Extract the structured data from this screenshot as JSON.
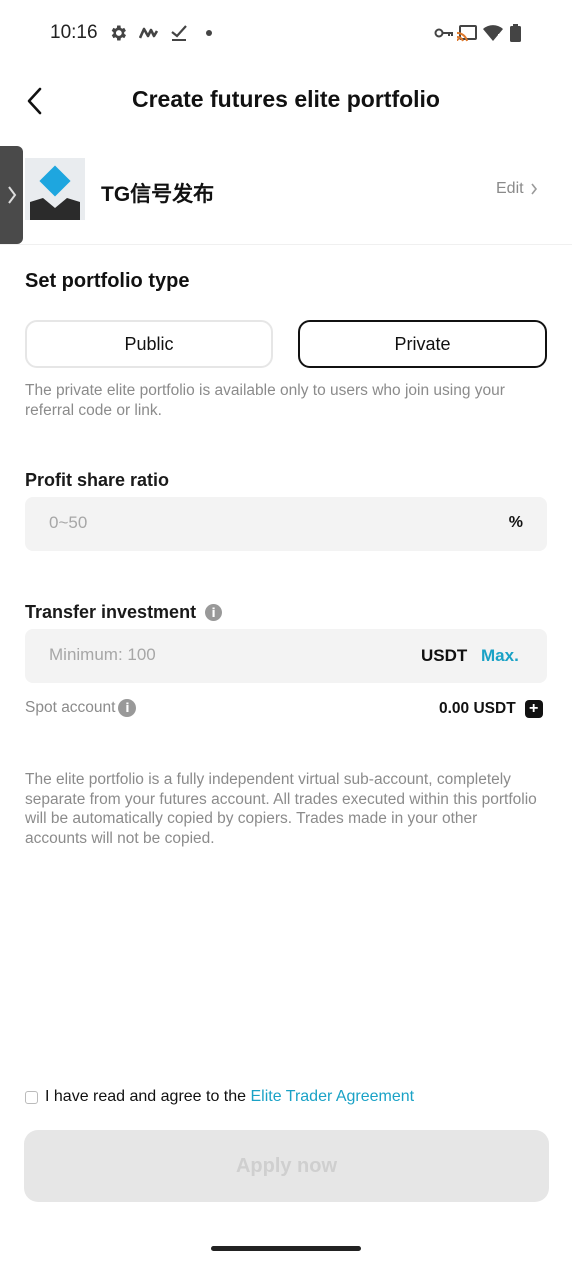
{
  "status_bar": {
    "time": "10:16",
    "left_icons": [
      "gear-icon",
      "app-m-icon",
      "check-icon",
      "dot-icon"
    ],
    "right_icons": [
      "key-icon",
      "cast-icon",
      "wifi-icon",
      "battery-icon"
    ]
  },
  "header": {
    "title": "Create futures elite portfolio",
    "back_icon": "chevron-left-icon"
  },
  "profile": {
    "name": "TG信号发布",
    "edit_label": "Edit",
    "colors": {
      "diamond": "#1ea6df",
      "base": "#2b2b2b"
    }
  },
  "portfolio_type": {
    "title": "Set portfolio type",
    "options": [
      "Public",
      "Private"
    ],
    "selected": "Private",
    "note": "The private elite portfolio is available only to users who join using your referral code or link."
  },
  "profit_share": {
    "label": "Profit share ratio",
    "placeholder": "0~50",
    "unit": "%"
  },
  "transfer": {
    "label": "Transfer investment",
    "placeholder": "Minimum: 100",
    "currency": "USDT",
    "max_label": "Max.",
    "spot_label": "Spot account",
    "spot_value": "0.00 USDT"
  },
  "disclaimer": "The elite portfolio is a fully independent virtual sub-account, completely separate from your futures account. All trades executed within this portfolio will be automatically copied by copiers. Trades made in your other accounts will not be copied.",
  "agreement": {
    "prefix": "I have read and agree to the ",
    "link": "Elite Trader Agreement",
    "checked": false
  },
  "apply_label": "Apply now",
  "colors": {
    "accent": "#1aa2c6",
    "button_disabled_bg": "#e6e6e6"
  }
}
